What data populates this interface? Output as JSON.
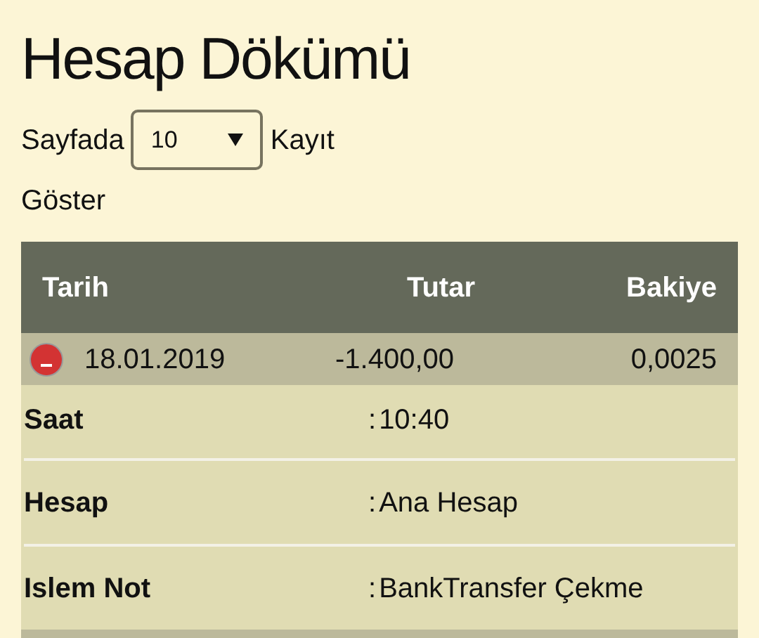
{
  "title": "Hesap Dökümü",
  "page_size": {
    "before": "Sayfada",
    "value": "10",
    "after": "Kayıt",
    "second_line": "Göster"
  },
  "table": {
    "columns": [
      "Tarih",
      "Tutar",
      "Bakiye"
    ],
    "rows": [
      {
        "expanded": true,
        "cells": [
          "18.01.2019",
          "-1.400,00",
          "0,0025"
        ],
        "details": [
          {
            "label": "Saat",
            "separator": ":",
            "value": "10:40"
          },
          {
            "label": "Hesap",
            "separator": ":",
            "value": "Ana Hesap"
          },
          {
            "label": "Islem Not",
            "separator": ":",
            "value": "BankTransfer Çekme"
          }
        ]
      }
    ]
  }
}
